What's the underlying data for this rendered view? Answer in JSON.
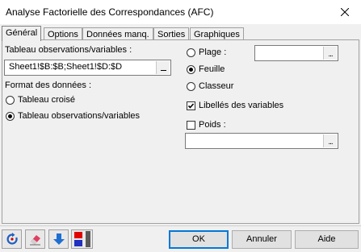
{
  "window": {
    "title": "Analyse Factorielle des Correspondances (AFC)"
  },
  "tabs": [
    {
      "label": "Général",
      "active": true
    },
    {
      "label": "Options"
    },
    {
      "label": "Données manq."
    },
    {
      "label": "Sorties"
    },
    {
      "label": "Graphiques"
    }
  ],
  "general": {
    "table_label": "Tableau observations/variables :",
    "table_value": "Sheet1!$B:$B;Sheet1!$D:$D",
    "format_label": "Format des données :",
    "format_options": [
      {
        "label": "Tableau croisé",
        "selected": false
      },
      {
        "label": "Tableau observations/variables",
        "selected": true
      }
    ],
    "output_options": [
      {
        "label": "Plage :",
        "selected": false
      },
      {
        "label": "Feuille",
        "selected": true
      },
      {
        "label": "Classeur",
        "selected": false
      }
    ],
    "plage_value": "",
    "labels_checkbox": {
      "label": "Libellés des variables",
      "checked": true
    },
    "poids_checkbox": {
      "label": "Poids :",
      "checked": false
    },
    "poids_value": "",
    "dots": "..."
  },
  "footer": {
    "ok_label": "OK",
    "cancel_label": "Annuler",
    "help_label": "Aide",
    "icons": [
      "reset-icon",
      "eraser-icon",
      "down-arrow-icon",
      "color-flag-icon"
    ]
  },
  "colors": {
    "accent": "#0078d7",
    "reset_blue": "#1f5fbf",
    "arrow_blue": "#1f6fd0",
    "flag_red": "#e00000",
    "flag_blue": "#2030c0"
  }
}
